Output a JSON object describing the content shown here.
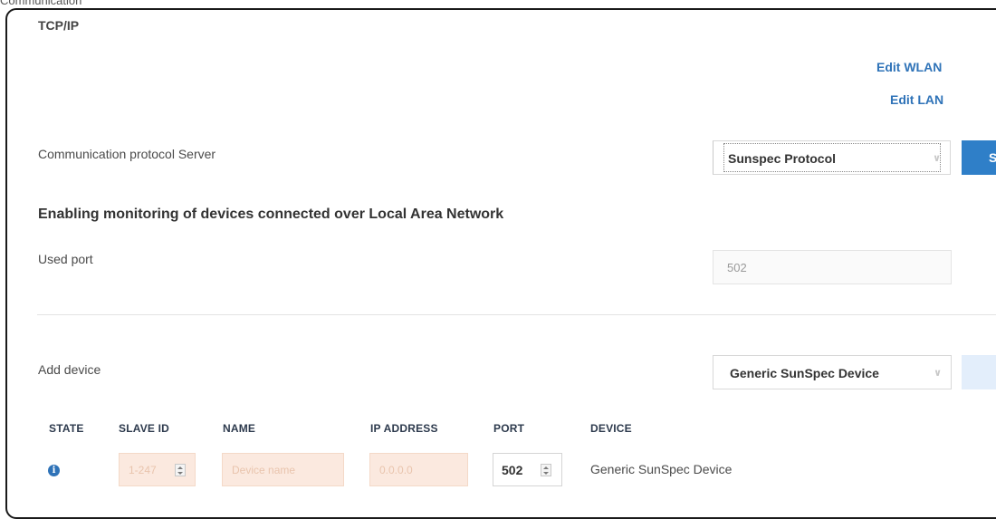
{
  "page": {
    "top_cut_text": "Communication",
    "section_title": "TCP/IP",
    "links": {
      "edit_wlan": "Edit WLAN",
      "edit_lan": "Edit LAN"
    },
    "comm_protocol": {
      "label": "Communication protocol Server",
      "selected": "Sunspec Protocol",
      "button_text": "S"
    },
    "monitoring_heading": "Enabling monitoring of devices connected over Local Area Network",
    "used_port": {
      "label": "Used port",
      "value": "502"
    },
    "add_device": {
      "label": "Add device",
      "selected": "Generic SunSpec Device"
    },
    "table": {
      "headers": [
        "STATE",
        "SLAVE ID",
        "NAME",
        "IP ADDRESS",
        "PORT",
        "DEVICE"
      ],
      "rows": [
        {
          "state_icon": "info-icon",
          "slave_id_placeholder": "1-247",
          "name_placeholder": "Device name",
          "ip_placeholder": "0.0.0.0",
          "port": "502",
          "device": "Generic SunSpec Device"
        }
      ]
    },
    "colors": {
      "accent": "#2f73b8",
      "button": "#2f7fc8",
      "invalid_bg": "#fbe9df"
    }
  }
}
